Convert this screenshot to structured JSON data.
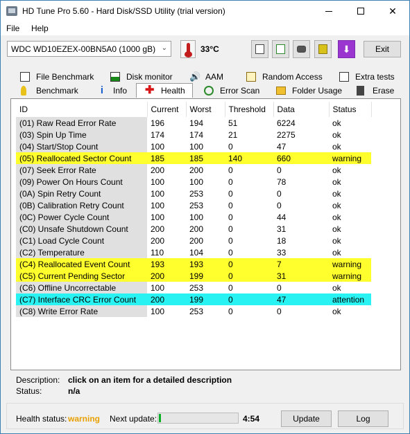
{
  "window": {
    "title": "HD Tune Pro 5.60 - Hard Disk/SSD Utility (trial version)"
  },
  "menu": {
    "file": "File",
    "help": "Help"
  },
  "toolbar": {
    "drive": "WDC WD10EZEX-00BN5A0 (1000 gB)",
    "temperature": "33°C",
    "exit_label": "Exit"
  },
  "tabs": [
    {
      "label": "File Benchmark",
      "icon": "file-benchmark-icon"
    },
    {
      "label": "Disk monitor",
      "icon": "disk-monitor-icon"
    },
    {
      "label": "AAM",
      "icon": "speaker-icon"
    },
    {
      "label": "Random Access",
      "icon": "random-access-icon"
    },
    {
      "label": "Extra tests",
      "icon": "extra-tests-icon"
    },
    {
      "label": "Benchmark",
      "icon": "benchmark-icon"
    },
    {
      "label": "Info",
      "icon": "info-icon"
    },
    {
      "label": "Health",
      "icon": "health-cross-icon",
      "active": true
    },
    {
      "label": "Error Scan",
      "icon": "error-scan-icon"
    },
    {
      "label": "Folder Usage",
      "icon": "folder-icon"
    },
    {
      "label": "Erase",
      "icon": "trash-icon"
    }
  ],
  "table": {
    "headers": [
      "ID",
      "Current",
      "Worst",
      "Threshold",
      "Data",
      "Status"
    ],
    "rows": [
      {
        "id": "(01) Raw Read Error Rate",
        "current": "196",
        "worst": "194",
        "threshold": "51",
        "data": "6224",
        "status": "ok"
      },
      {
        "id": "(03) Spin Up Time",
        "current": "174",
        "worst": "174",
        "threshold": "21",
        "data": "2275",
        "status": "ok"
      },
      {
        "id": "(04) Start/Stop Count",
        "current": "100",
        "worst": "100",
        "threshold": "0",
        "data": "47",
        "status": "ok"
      },
      {
        "id": "(05) Reallocated Sector Count",
        "current": "185",
        "worst": "185",
        "threshold": "140",
        "data": "660",
        "status": "warning"
      },
      {
        "id": "(07) Seek Error Rate",
        "current": "200",
        "worst": "200",
        "threshold": "0",
        "data": "0",
        "status": "ok"
      },
      {
        "id": "(09) Power On Hours Count",
        "current": "100",
        "worst": "100",
        "threshold": "0",
        "data": "78",
        "status": "ok"
      },
      {
        "id": "(0A) Spin Retry Count",
        "current": "100",
        "worst": "253",
        "threshold": "0",
        "data": "0",
        "status": "ok"
      },
      {
        "id": "(0B) Calibration Retry Count",
        "current": "100",
        "worst": "253",
        "threshold": "0",
        "data": "0",
        "status": "ok"
      },
      {
        "id": "(0C) Power Cycle Count",
        "current": "100",
        "worst": "100",
        "threshold": "0",
        "data": "44",
        "status": "ok"
      },
      {
        "id": "(C0) Unsafe Shutdown Count",
        "current": "200",
        "worst": "200",
        "threshold": "0",
        "data": "31",
        "status": "ok"
      },
      {
        "id": "(C1) Load Cycle Count",
        "current": "200",
        "worst": "200",
        "threshold": "0",
        "data": "18",
        "status": "ok"
      },
      {
        "id": "(C2) Temperature",
        "current": "110",
        "worst": "104",
        "threshold": "0",
        "data": "33",
        "status": "ok"
      },
      {
        "id": "(C4) Reallocated Event Count",
        "current": "193",
        "worst": "193",
        "threshold": "0",
        "data": "7",
        "status": "warning"
      },
      {
        "id": "(C5) Current Pending Sector",
        "current": "200",
        "worst": "199",
        "threshold": "0",
        "data": "31",
        "status": "warning"
      },
      {
        "id": "(C6) Offline Uncorrectable",
        "current": "100",
        "worst": "253",
        "threshold": "0",
        "data": "0",
        "status": "ok"
      },
      {
        "id": "(C7) Interface CRC Error Count",
        "current": "200",
        "worst": "199",
        "threshold": "0",
        "data": "47",
        "status": "attention"
      },
      {
        "id": "(C8) Write Error Rate",
        "current": "100",
        "worst": "253",
        "threshold": "0",
        "data": "0",
        "status": "ok"
      }
    ]
  },
  "description": {
    "desc_label": "Description:",
    "desc_value": "click on an item for a detailed description",
    "status_label": "Status:",
    "status_value": "n/a"
  },
  "footer": {
    "health_label": "Health status:",
    "health_value": "warning",
    "next_update_label": "Next update:",
    "progress_fraction": 0.03,
    "countdown": "4:54",
    "update_label": "Update",
    "log_label": "Log"
  },
  "colors": {
    "warning": "#ffff2e",
    "attention": "#28f2f2",
    "health_warning_text": "#e8a000",
    "progress": "#06b025"
  }
}
